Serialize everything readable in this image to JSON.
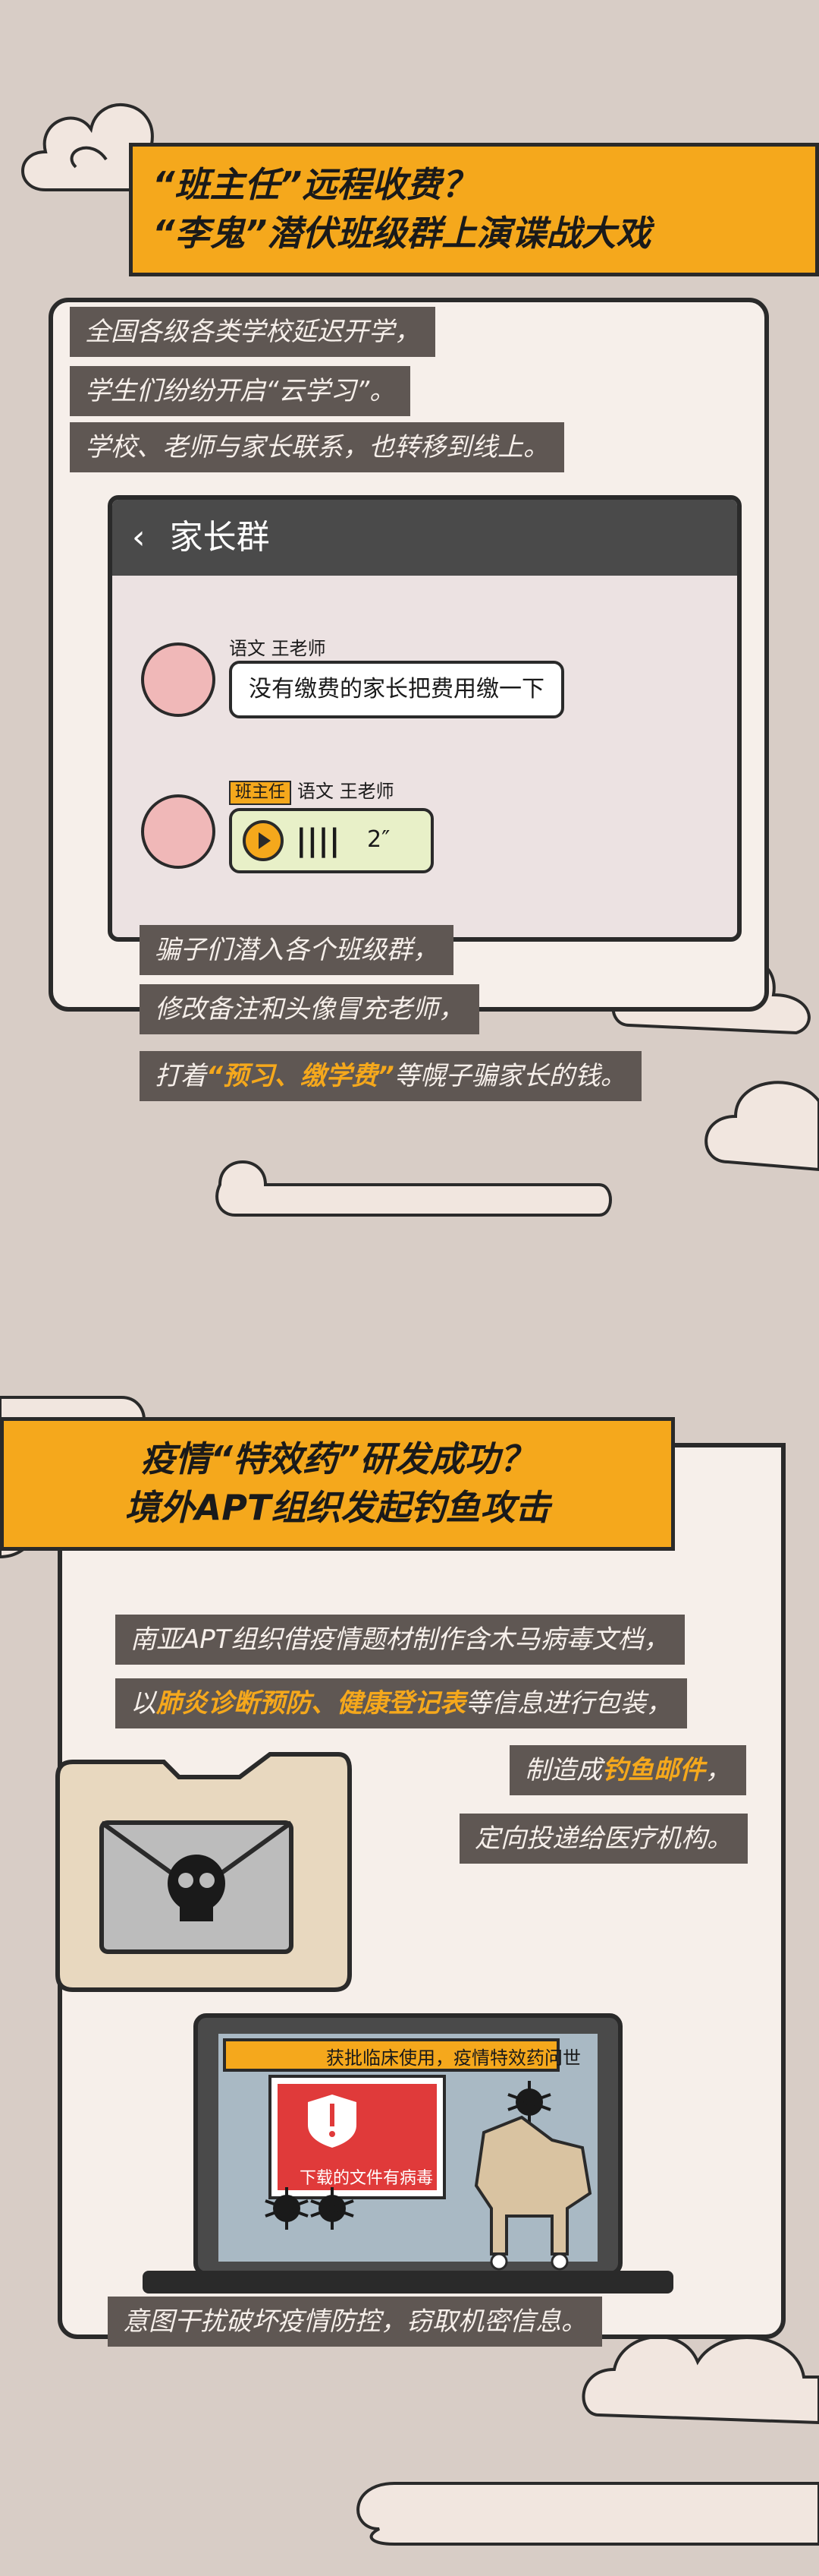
{
  "section1": {
    "title_line1": "“班主任”远程收费？",
    "title_line2": "“李鬼”潜伏班级群上演谍战大戏",
    "captions": [
      "全国各级各类学校延迟开学，",
      "学生们纷纷开启“云学习”。",
      "学校、老师与家长联系，也转移到线上。"
    ],
    "chat": {
      "back_glyph": "‹",
      "title": "家长群",
      "msg1_name": "语文 王老师",
      "msg1_text": "没有缴费的家长把费用缴一下",
      "msg2_tag": "班主任",
      "msg2_name": "语文 王老师",
      "msg2_voice": "2″"
    },
    "bottom_captions": {
      "line1": "骗子们潜入各个班级群，",
      "line2": "修改备注和头像冒充老师，",
      "line3_pre": "打着",
      "line3_hl": "“预习、缴学费”",
      "line3_post": "等幌子骗家长的钱。"
    }
  },
  "section2": {
    "title_line1": "疫情“特效药”研发成功？",
    "title_line2": "境外APT组织发起钓鱼攻击",
    "captions": {
      "line1": "南亚APT组织借疫情题材制作含木马病毒文档，",
      "line2_pre": "以",
      "line2_hl": "肺炎诊断预防、健康登记表",
      "line2_post": "等信息进行包装，",
      "line3_pre": "制造成",
      "line3_hl": "钓鱼邮件",
      "line3_post": "，",
      "line4": "定向投递给医疗机构。",
      "final": "意图干扰破坏疫情防控，窃取机密信息。"
    },
    "screen": {
      "email_subject": "获批临床使用，疫情特效药问世",
      "warning_text": "下载的文件有病毒"
    }
  },
  "colors": {
    "accent": "#f5a81c",
    "background": "#d8cdc6",
    "caption_bg": "#5f5753",
    "panel": "#f6efea",
    "dark": "#2a2a2a"
  }
}
